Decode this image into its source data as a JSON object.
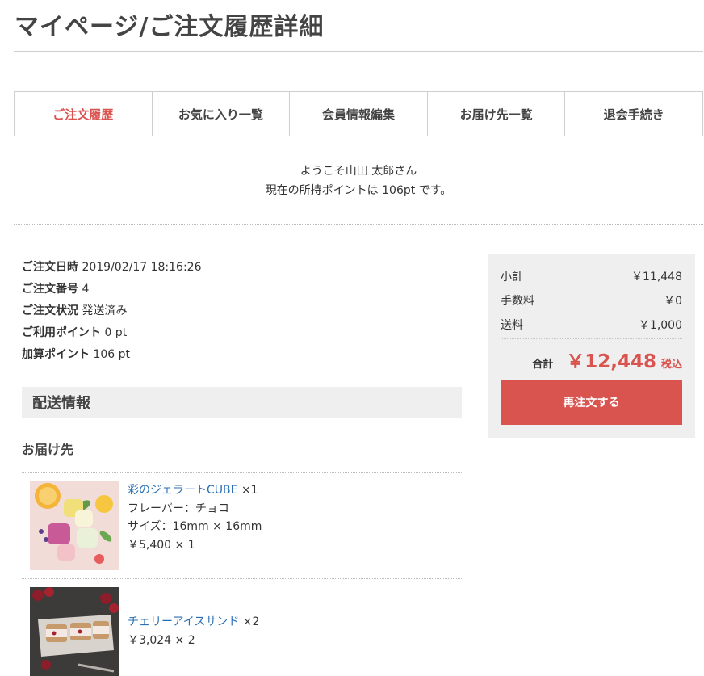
{
  "page": {
    "title": "マイページ/ご注文履歴詳細"
  },
  "tabs": [
    {
      "label": "ご注文履歴",
      "active": true
    },
    {
      "label": "お気に入り一覧",
      "active": false
    },
    {
      "label": "会員情報編集",
      "active": false
    },
    {
      "label": "お届け先一覧",
      "active": false
    },
    {
      "label": "退会手続き",
      "active": false
    }
  ],
  "welcome": {
    "line1": "ようこそ山田 太郎さん",
    "line2": "現在の所持ポイントは 106pt です。"
  },
  "order": {
    "date_label": "ご注文日時",
    "date": "2019/02/17 18:16:26",
    "number_label": "ご注文番号",
    "number": "4",
    "status_label": "ご注文状況",
    "status": "発送済み",
    "used_points_label": "ご利用ポイント",
    "used_points": "0 pt",
    "added_points_label": "加算ポイント",
    "added_points": "106 pt"
  },
  "shipping": {
    "section_title": "配送情報",
    "destination_label": "お届け先"
  },
  "items": [
    {
      "name": "彩のジェラートCUBE",
      "qty": "×1",
      "flavor": "フレーバー：チョコ",
      "size": "サイズ：16mm × 16mm",
      "price": "￥5,400 × 1",
      "image_icon": "gelato-photo"
    },
    {
      "name": "チェリーアイスサンド",
      "qty": "×2",
      "price": "￥3,024 × 2",
      "image_icon": "ice-sandwich-photo"
    }
  ],
  "summary": {
    "subtotal_label": "小計",
    "subtotal": "￥11,448",
    "fee_label": "手数料",
    "fee": "￥0",
    "shipping_label": "送料",
    "shipping": "￥1,000",
    "total_label": "合計",
    "total": "￥12,448",
    "tax_label": "税込",
    "reorder_button": "再注文する"
  },
  "colors": {
    "accent": "#d9534f",
    "link": "#2a6fb3",
    "panel": "#efefef"
  }
}
